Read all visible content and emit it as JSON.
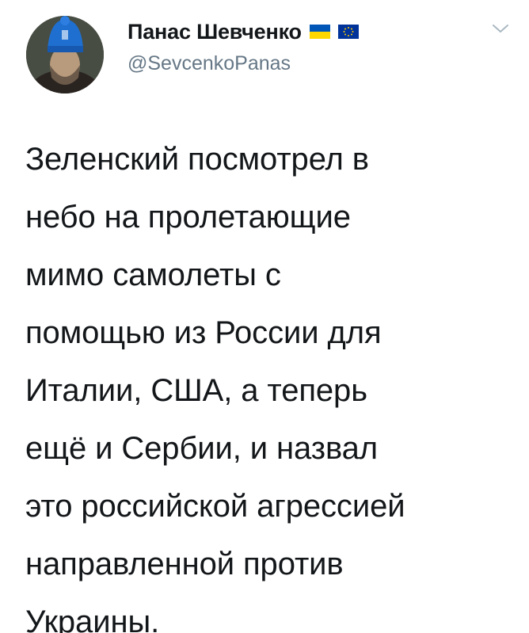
{
  "author": {
    "display_name": "Панас Шевченко",
    "handle": "@SevcenkoPanas",
    "avatar_icon": "profile-photo",
    "flags": [
      "flag-ukraine-icon",
      "flag-eu-icon"
    ]
  },
  "menu_icon": "chevron-down-icon",
  "tweet": {
    "text": "Зеленский посмотрел в\nнебо на пролетающие\nмимо самолеты с\nпомощью из России для\nИталии, США, а теперь\nещё и Сербии, и назвал\nэто российской агрессией\nнаправленной против\nУкраины."
  },
  "colors": {
    "text": "#14171a",
    "handle": "#657786",
    "flag_blue": "#0057b7",
    "flag_yellow": "#ffd700",
    "eu_blue": "#003399",
    "eu_star": "#ffcc00"
  }
}
